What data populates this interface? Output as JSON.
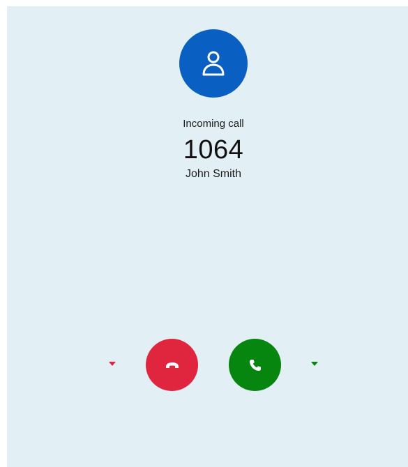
{
  "call": {
    "status": "Incoming call",
    "number": "1064",
    "caller_name": "John Smith"
  },
  "avatar": {
    "icon": "person-icon",
    "color": "#0a5fc2"
  },
  "actions": {
    "decline": {
      "icon": "hang-up-icon",
      "color": "#e0253f",
      "menu_icon": "caret-down-icon"
    },
    "accept": {
      "icon": "phone-icon",
      "color": "#06850f",
      "menu_icon": "caret-down-icon"
    }
  }
}
